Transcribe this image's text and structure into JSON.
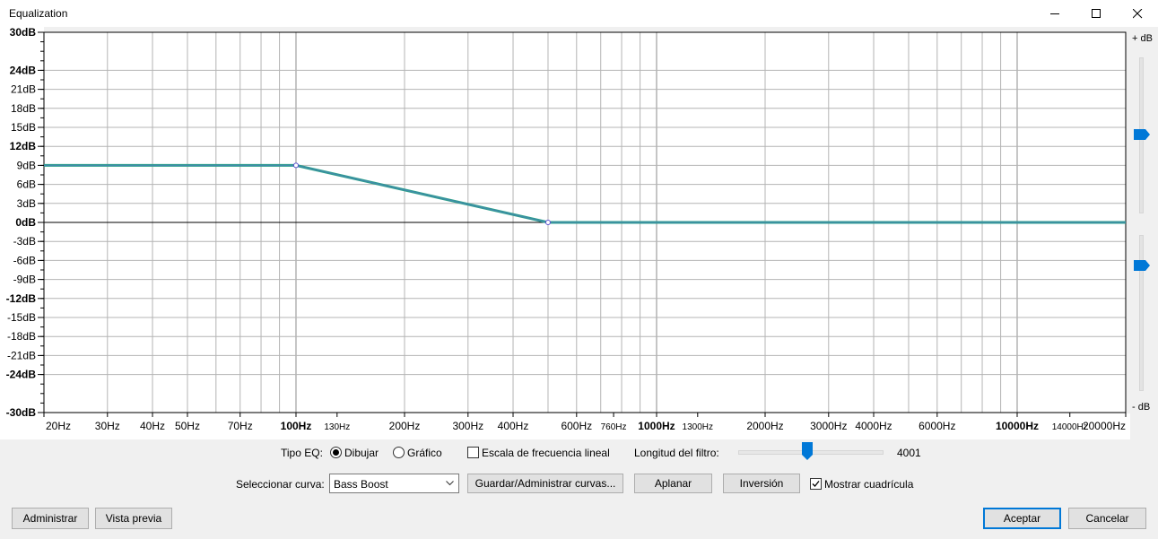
{
  "window": {
    "title": "Equalization",
    "minimize_icon": "minimize-icon",
    "maximize_icon": "maximize-icon",
    "close_icon": "close-icon"
  },
  "graph": {
    "db_labels": [
      "30dB",
      "24dB",
      "21dB",
      "18dB",
      "15dB",
      "12dB",
      "9dB",
      "6dB",
      "3dB",
      "0dB",
      "-3dB",
      "-6dB",
      "-9dB",
      "-12dB",
      "-15dB",
      "-18dB",
      "-21dB",
      "-24dB",
      "-30dB"
    ],
    "bold_db_labels": [
      "30dB",
      "24dB",
      "12dB",
      "0dB",
      "-12dB",
      "-24dB",
      "-30dB"
    ],
    "freq_labels": [
      "20Hz",
      "30Hz",
      "40Hz",
      "50Hz",
      "70Hz",
      "100Hz",
      "130Hz",
      "200Hz",
      "300Hz",
      "400Hz",
      "600Hz",
      "760Hz",
      "1000Hz",
      "1300Hz",
      "2000Hz",
      "3000Hz",
      "4000Hz",
      "6000Hz",
      "10000Hz",
      "14000Hz",
      "20000Hz"
    ],
    "bold_freq_labels": [
      "100Hz",
      "1000Hz",
      "10000Hz"
    ],
    "small_freq_labels": [
      "130Hz",
      "760Hz",
      "1300Hz",
      "14000Hz"
    ],
    "curve_color": "#2e9e8c",
    "curve_points": [
      {
        "freq_hz": 20,
        "db": 9
      },
      {
        "freq_hz": 100,
        "db": 9
      },
      {
        "freq_hz": 500,
        "db": 0
      },
      {
        "freq_hz": 20000,
        "db": 0
      }
    ]
  },
  "gain_sliders": {
    "top_label": "+ dB",
    "bottom_label": "- dB",
    "max_gain_db": 12,
    "min_gain_db": -30,
    "accent_color": "#0078d7"
  },
  "controls": {
    "eq_type_label": "Tipo EQ:",
    "draw_label": "Dibujar",
    "graphic_label": "Gráfico",
    "eq_type_selected": "Dibujar",
    "linear_scale_label": "Escala de frecuencia lineal",
    "linear_scale_checked": false,
    "filter_length_label": "Longitud del filtro:",
    "filter_length_value": "4001",
    "select_curve_label": "Seleccionar curva:",
    "curve_selected": "Bass Boost",
    "save_manage_label": "Guardar/Administrar curvas...",
    "flatten_label": "Aplanar",
    "invert_label": "Inversión",
    "show_grid_label": "Mostrar cuadrícula",
    "show_grid_checked": true
  },
  "footer": {
    "manage_label": "Administrar",
    "preview_label": "Vista previa",
    "ok_label": "Aceptar",
    "cancel_label": "Cancelar"
  }
}
